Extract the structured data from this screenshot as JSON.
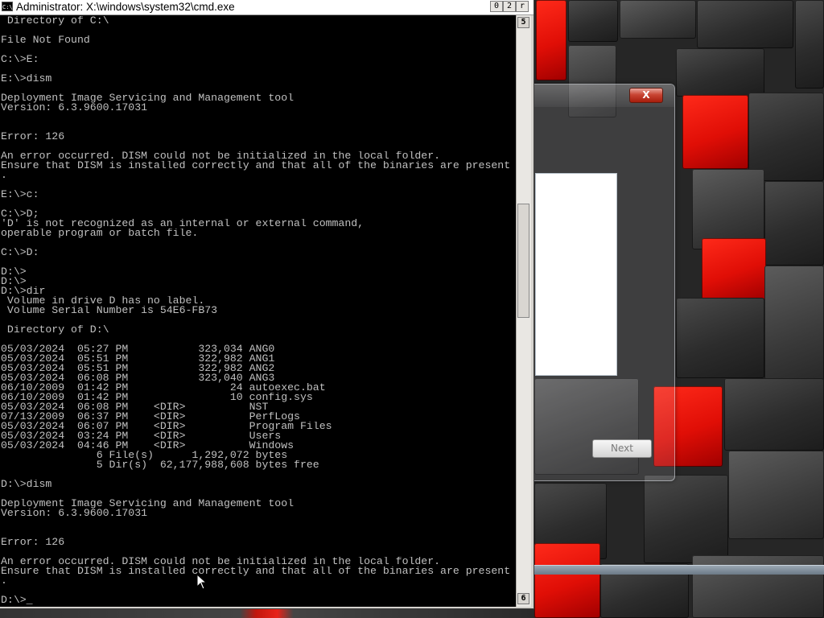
{
  "cmd_window": {
    "title": "Administrator: X:\\windows\\system32\\cmd.exe",
    "icon_label": "C:\\",
    "buttons": {
      "minimize": "0",
      "maximize": "2",
      "close": "r"
    },
    "scrollbar": {
      "up_arrow": "5",
      "down_arrow": "6"
    },
    "console_lines": [
      " Directory of C:\\",
      "",
      "File Not Found",
      "",
      "C:\\>E:",
      "",
      "E:\\>dism",
      "",
      "Deployment Image Servicing and Management tool",
      "Version: 6.3.9600.17031",
      "",
      "",
      "Error: 126",
      "",
      "An error occurred. DISM could not be initialized in the local folder.",
      "Ensure that DISM is installed correctly and that all of the binaries are present",
      ".",
      "",
      "E:\\>c:",
      "",
      "C:\\>D;",
      "'D' is not recognized as an internal or external command,",
      "operable program or batch file.",
      "",
      "C:\\>D:",
      "",
      "D:\\>",
      "D:\\>",
      "D:\\>dir",
      " Volume in drive D has no label.",
      " Volume Serial Number is 54E6-FB73",
      "",
      " Directory of D:\\",
      "",
      "05/03/2024  05:27 PM           323,034 ANG0",
      "05/03/2024  05:51 PM           322,982 ANG1",
      "05/03/2024  05:51 PM           322,982 ANG2",
      "05/03/2024  06:08 PM           323,040 ANG3",
      "06/10/2009  01:42 PM                24 autoexec.bat",
      "06/10/2009  01:42 PM                10 config.sys",
      "05/03/2024  06:08 PM    <DIR>          NST",
      "07/13/2009  06:37 PM    <DIR>          PerfLogs",
      "05/03/2024  06:07 PM    <DIR>          Program Files",
      "05/03/2024  03:24 PM    <DIR>          Users",
      "05/03/2024  04:46 PM    <DIR>          Windows",
      "               6 File(s)      1,292,072 bytes",
      "               5 Dir(s)  62,177,988,608 bytes free",
      "",
      "D:\\>dism",
      "",
      "Deployment Image Servicing and Management tool",
      "Version: 6.3.9600.17031",
      "",
      "",
      "Error: 126",
      "",
      "An error occurred. DISM could not be initialized in the local folder.",
      "Ensure that DISM is installed correctly and that all of the binaries are present",
      ".",
      "",
      "D:\\>_"
    ]
  },
  "setup_window": {
    "close_label": "X",
    "next_label": "Next"
  },
  "colors": {
    "console_bg": "#000000",
    "console_text": "#c0c0c0",
    "desktop_red": "#e00e06",
    "desktop_dark": "#2c2c2c"
  }
}
